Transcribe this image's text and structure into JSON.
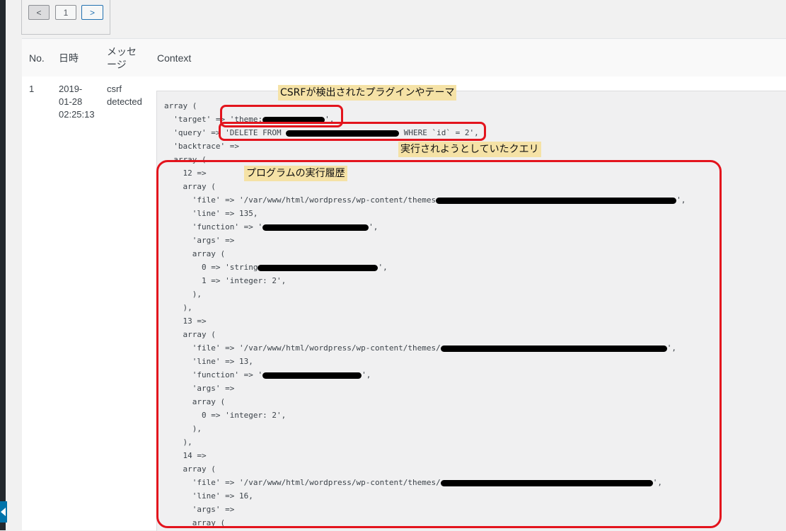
{
  "pagination": {
    "prev": "<",
    "page": "1",
    "next": ">"
  },
  "table": {
    "headers": {
      "no": "No.",
      "date": "日時",
      "message": "メッセージ",
      "context": "Context"
    },
    "row": {
      "no": "1",
      "date": [
        "2019-",
        "01-28",
        "02:25:13"
      ],
      "message": [
        "csrf",
        "detected"
      ]
    }
  },
  "code": {
    "l1": "array (",
    "l2": "  'target' => 'theme:",
    "l2b": "',",
    "l3": "  'query' => 'DELETE FROM ",
    "l3b": " WHERE `id` = 2',",
    "l4": "  'backtrace' =>",
    "l5": "  array (",
    "l6": "    12 =>",
    "l7": "    array (",
    "l8": "      'file' => '/var/www/html/wordpress/wp-content/themes",
    "l8b": "',",
    "l9": "      'line' => 135,",
    "l10": "      'function' => '",
    "l10b": "',",
    "l11": "      'args' =>",
    "l12": "      array (",
    "l13": "        0 => 'string",
    "l13b": "',",
    "l14": "        1 => 'integer: 2',",
    "l15": "      ),",
    "l16": "    ),",
    "l17": "    13 =>",
    "l18": "    array (",
    "l19": "      'file' => '/var/www/html/wordpress/wp-content/themes/",
    "l19b": "',",
    "l20": "      'line' => 13,",
    "l21": "      'function' => '",
    "l21b": "',",
    "l22": "      'args' =>",
    "l23": "      array (",
    "l24": "        0 => 'integer: 2',",
    "l25": "      ),",
    "l26": "    ),",
    "l27": "    14 =>",
    "l28": "    array (",
    "l29": "      'file' => '/var/www/html/wordpress/wp-content/themes/",
    "l29b": "',",
    "l30": "      'line' => 16,",
    "l31": "      'args' =>",
    "l32": "      array ("
  },
  "annotations": {
    "csrf_target": "CSRFが検出されたプラグインやテーマ",
    "query": "実行されようとしていたクエリ",
    "trace": "プログラムの実行履歴"
  },
  "colors": {
    "highlight_box": "#e3141d",
    "note_bg": "#f5e2a6",
    "link_blue": "#2271b1"
  }
}
